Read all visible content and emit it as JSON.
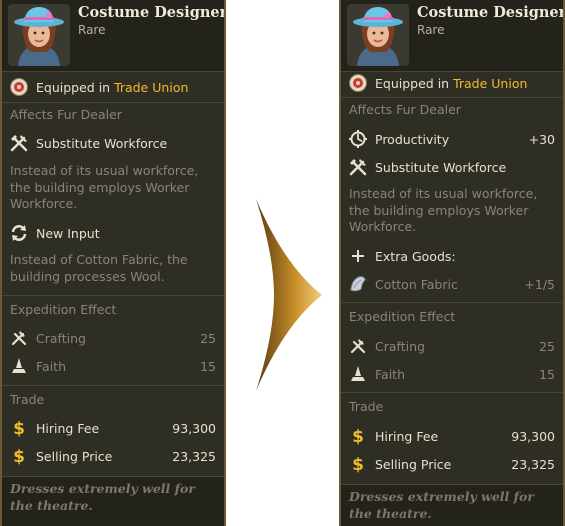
{
  "before": {
    "title": "Costume Designer",
    "rarity": "Rare",
    "equipped_prefix": "Equipped in",
    "equipped_place": "Trade Union",
    "affects": "Affects Fur Dealer",
    "effect1_title": "Substitute Workforce",
    "effect1_desc": "Instead of its usual workforce, the building employs Worker Workforce.",
    "effect2_title": "New Input",
    "effect2_desc": "Instead of Cotton Fabric, the building processes Wool.",
    "expedition_header": "Expedition Effect",
    "crafting_label": "Crafting",
    "crafting_value": "25",
    "faith_label": "Faith",
    "faith_value": "15",
    "trade_header": "Trade",
    "hiring_label": "Hiring Fee",
    "hiring_value": "93,300",
    "selling_label": "Selling Price",
    "selling_value": "23,325",
    "flavor": "Dresses extremely well for the theatre."
  },
  "after": {
    "title": "Costume Designer",
    "rarity": "Rare",
    "equipped_prefix": "Equipped in",
    "equipped_place": "Trade Union",
    "affects": "Affects Fur Dealer",
    "productivity_label": "Productivity",
    "productivity_value": "+30",
    "effect1_title": "Substitute Workforce",
    "effect1_desc": "Instead of its usual workforce, the building employs Worker Workforce.",
    "extra_goods_label": "Extra Goods:",
    "cotton_label": "Cotton Fabric",
    "cotton_value": "+1/5",
    "expedition_header": "Expedition Effect",
    "crafting_label": "Crafting",
    "crafting_value": "25",
    "faith_label": "Faith",
    "faith_value": "15",
    "trade_header": "Trade",
    "hiring_label": "Hiring Fee",
    "hiring_value": "93,300",
    "selling_label": "Selling Price",
    "selling_value": "23,325",
    "flavor": "Dresses extremely well for the theatre."
  },
  "colors": {
    "panel_bg": "#2f2e25",
    "header_bg": "#23231c",
    "highlight": "#f3bb2a",
    "dim_text": "#8a8574",
    "border": "#6c5a34"
  },
  "icons": [
    "portrait-icon",
    "trade-union-seal-icon",
    "hammer-pick-icon",
    "cycle-arrows-icon",
    "productivity-gear-icon",
    "plus-icon",
    "cotton-fabric-icon",
    "crafting-icon",
    "faith-icon",
    "dollar-icon",
    "arrow-icon"
  ]
}
